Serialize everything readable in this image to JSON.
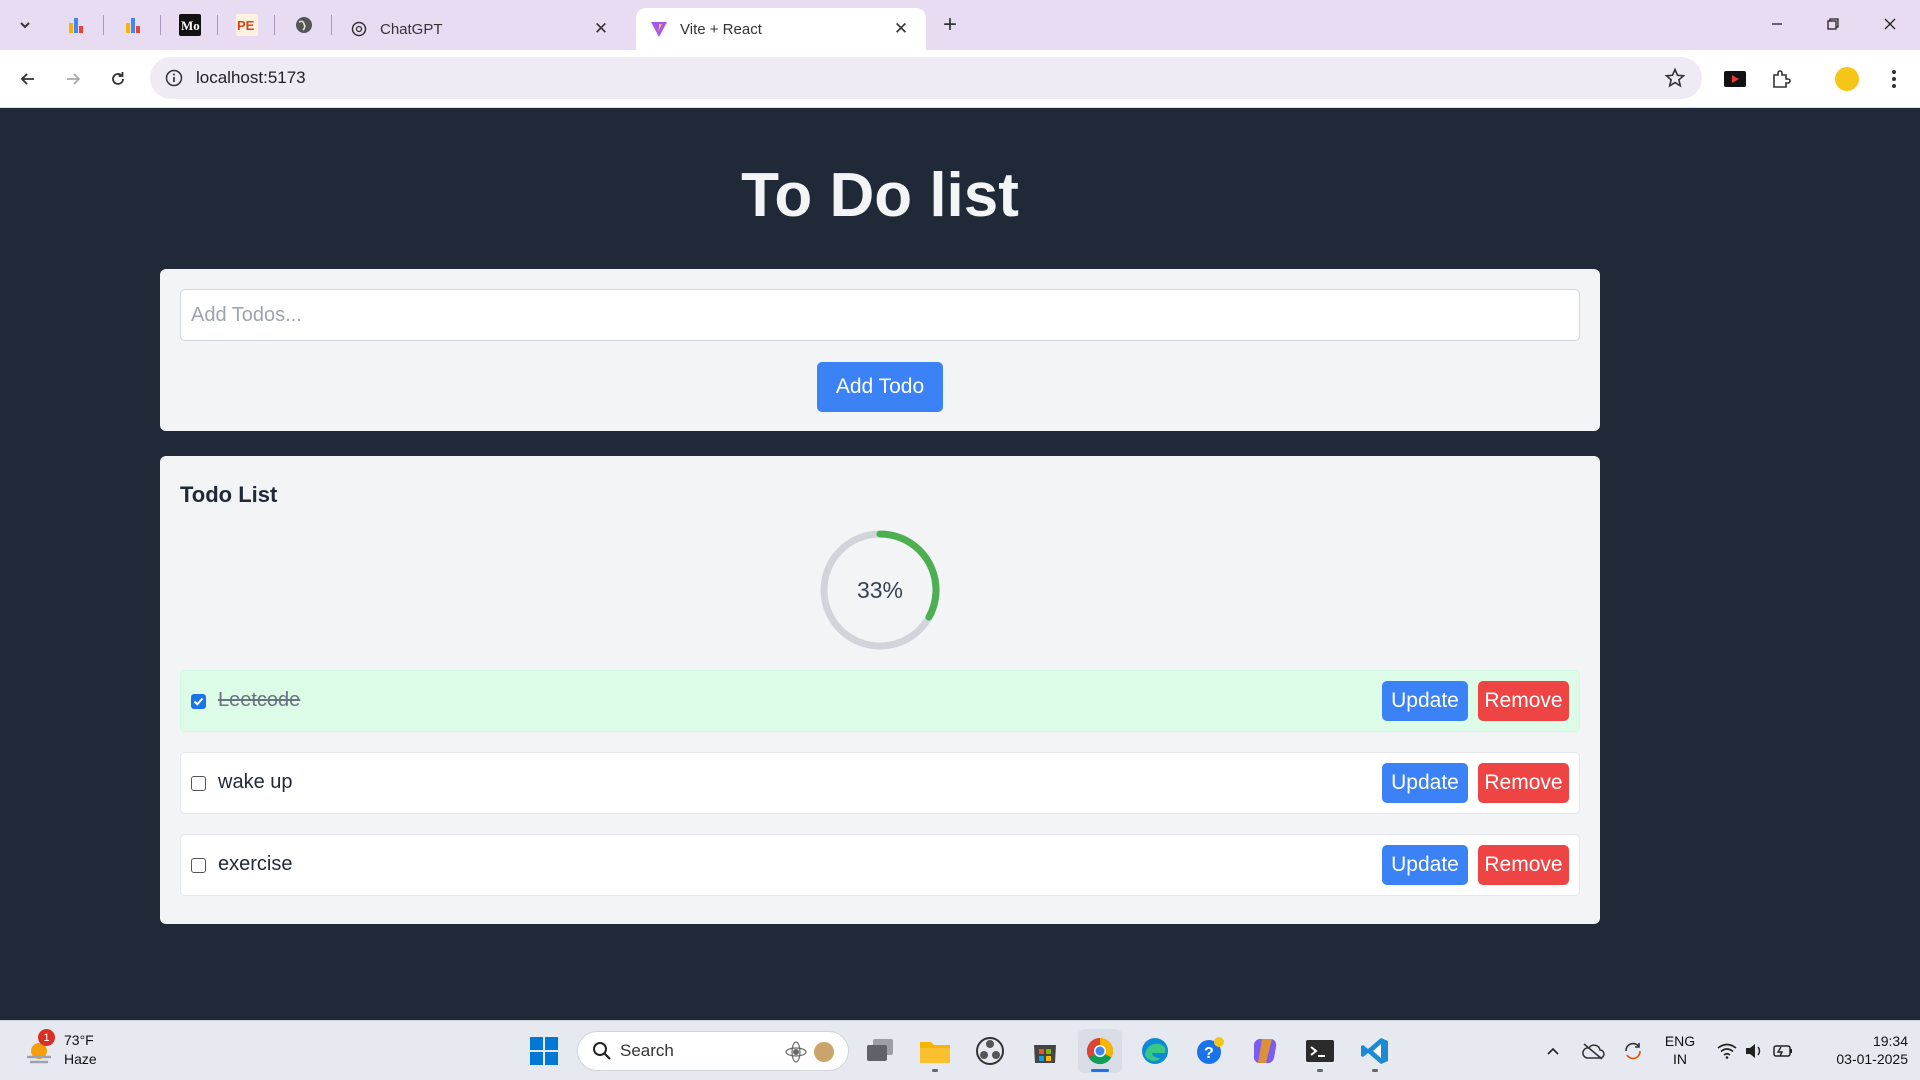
{
  "browser": {
    "tabs": [
      {
        "title": "ChatGPT",
        "active": false
      },
      {
        "title": "Vite + React",
        "active": true
      }
    ],
    "url": "localhost:5173"
  },
  "page": {
    "title": "To Do list",
    "input_placeholder": "Add Todos...",
    "add_button": "Add Todo",
    "list_title": "Todo List",
    "progress": {
      "value": 33,
      "label": "33%",
      "track_color": "#d1d5db",
      "fill_color": "#4caf50"
    },
    "todos": [
      {
        "text": "Leetcode",
        "done": true
      },
      {
        "text": "wake up",
        "done": false
      },
      {
        "text": "exercise",
        "done": false
      }
    ],
    "update_label": "Update",
    "remove_label": "Remove",
    "colors": {
      "background": "#1f2937",
      "card": "#f3f4f6",
      "primary": "#3b82f6",
      "danger": "#ef4444",
      "done_row": "#dcfce7"
    }
  },
  "taskbar": {
    "weather": {
      "temp": "73°F",
      "condition": "Haze",
      "badge": "1"
    },
    "search_label": "Search",
    "language": {
      "line1": "ENG",
      "line2": "IN"
    },
    "clock": {
      "time": "19:34",
      "date": "03-01-2025"
    }
  }
}
